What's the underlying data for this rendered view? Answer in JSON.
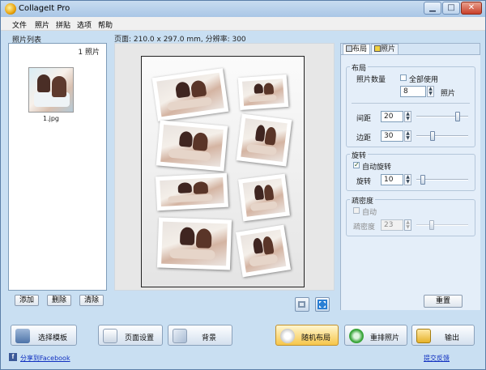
{
  "window": {
    "title": "CollageIt Pro",
    "min_glyph": "▁",
    "max_glyph": "□",
    "close_glyph": "✕"
  },
  "menu": [
    "文件",
    "照片",
    "拼贴",
    "选项",
    "帮助"
  ],
  "photo_list": {
    "title": "照片列表",
    "count": "1 照片",
    "items": [
      {
        "name": "1.jpg"
      }
    ],
    "buttons": {
      "add": "添加",
      "delete": "删除",
      "clear": "清除"
    }
  },
  "page_info": "页面: 210.0 x 297.0 mm, 分辨率: 300",
  "tabs": {
    "layout": "布局",
    "photo": "照片"
  },
  "layout_group": {
    "title": "布局",
    "photo_count_label": "照片数量",
    "use_all_label": "全部使用",
    "use_all_checked": false,
    "photo_count": "8",
    "photo_unit": "照片",
    "spacing_label": "间距",
    "spacing": "20",
    "spacing_level": 0.8,
    "margin_label": "边距",
    "margin": "30",
    "margin_level": 0.32
  },
  "rotation_group": {
    "title": "旋转",
    "auto_label": "自动旋转",
    "auto_checked": true,
    "check_glyph": "✓",
    "rotation_label": "旋转",
    "rotation": "10",
    "rotation_level": 0.12
  },
  "sparsity_group": {
    "title": "疏密度",
    "auto_label": "自动",
    "auto_checked": false,
    "sparsity_label": "疏密度",
    "sparsity": "23",
    "sparsity_level": 0.3
  },
  "reset_label": "重置",
  "bottom_buttons": {
    "template": "选择模板",
    "page_setup": "页面设置",
    "background": "背景",
    "random_layout": "随机布局",
    "shuffle": "重排照片",
    "output": "输出"
  },
  "share_facebook": "分享到Facebook",
  "feedback": "提交反馈",
  "colors": {
    "accent": "#f6c64a",
    "link": "#1030c0",
    "facebook": "#3b5998"
  },
  "icons": [
    "app-icon",
    "layout-tab-icon",
    "photo-tab-icon",
    "crop-icon",
    "fit-icon",
    "template-icon",
    "page-setup-icon",
    "background-icon",
    "random-layout-icon",
    "shuffle-icon",
    "output-icon",
    "facebook-icon"
  ]
}
